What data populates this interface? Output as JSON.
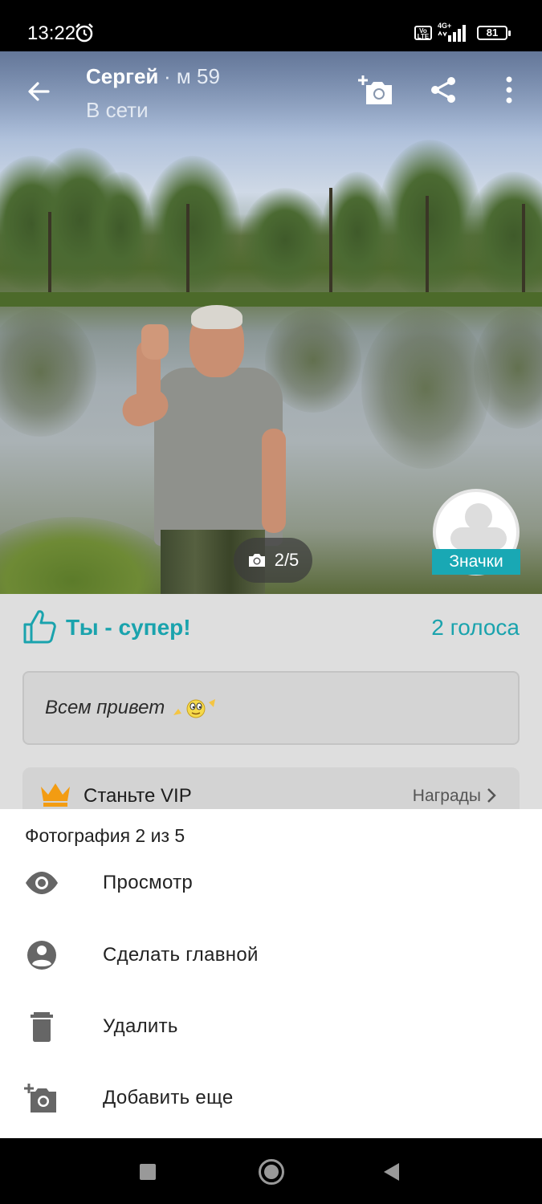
{
  "status_bar": {
    "time": "13:22",
    "network": "4G+",
    "battery": "81",
    "icons": [
      "alarm-icon",
      "volte-icon",
      "signal-icon",
      "battery-icon"
    ]
  },
  "header": {
    "name": "Сергей",
    "meta": "· м 59",
    "status": "В сети",
    "icons": [
      "back-arrow-icon",
      "add-photo-icon",
      "share-icon",
      "more-vert-icon"
    ]
  },
  "photo": {
    "counter": "2/5",
    "badges_label": "Значки"
  },
  "profile": {
    "like_text": "Ты - супер!",
    "votes": "2 голоса",
    "status_message": "Всем привет",
    "vip_text": "Станьте VIP",
    "awards_link": "Награды"
  },
  "sheet": {
    "title": "Фотография 2 из 5",
    "items": [
      {
        "label": "Просмотр",
        "icon": "eye-icon"
      },
      {
        "label": "Сделать главной",
        "icon": "account-circle-icon"
      },
      {
        "label": "Удалить",
        "icon": "trash-icon"
      },
      {
        "label": "Добавить еще",
        "icon": "add-photo-icon"
      }
    ]
  },
  "colors": {
    "accent": "#1aa3ad",
    "crown": "#f39c12",
    "badge": "#19a8b4"
  }
}
